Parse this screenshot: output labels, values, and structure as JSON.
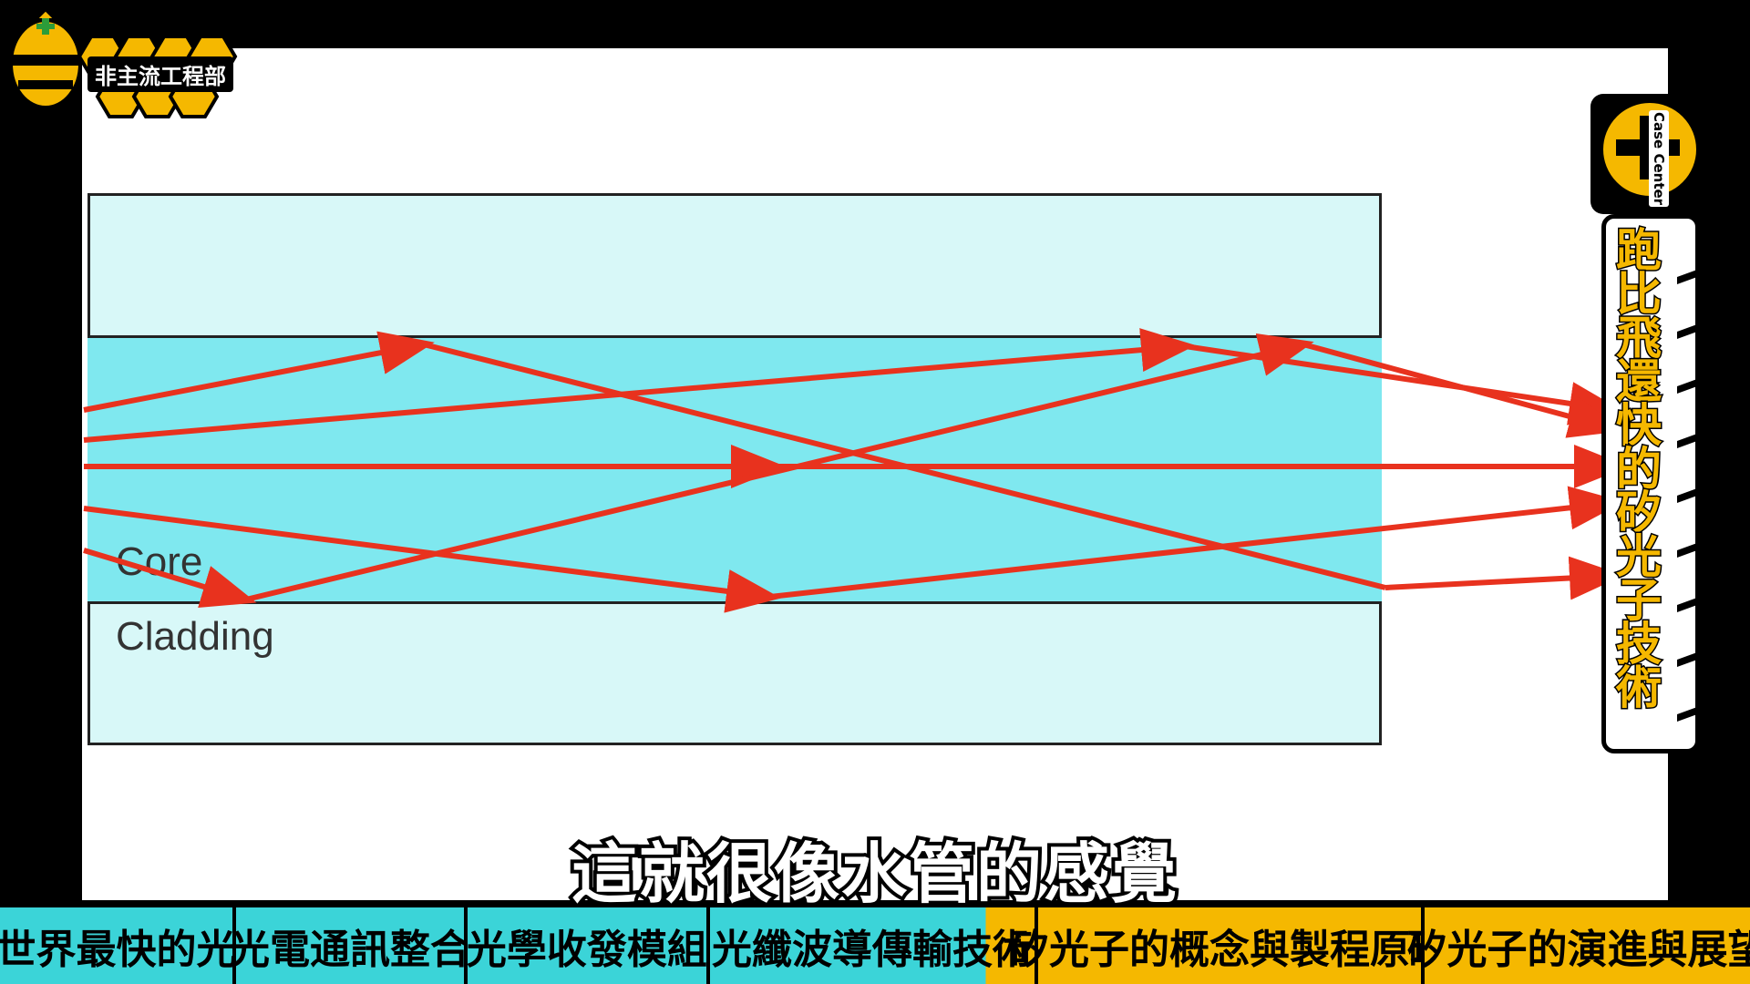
{
  "brand": {
    "name": "非主流工程部"
  },
  "badge": {
    "text": "Case Center"
  },
  "vertical_title": "跑比飛還快的矽光子技術",
  "diagram": {
    "core_label": "Core",
    "cladding_label": "Cladding"
  },
  "subtitle": "這就很像水管的感覺",
  "chapters": [
    {
      "label": "世界最快的光"
    },
    {
      "label": "光電通訊整合"
    },
    {
      "label": "光學收發模組"
    },
    {
      "label": "光纖波導傳輸技術"
    },
    {
      "label": "矽光子的概念與製程原理"
    },
    {
      "label": "矽光子的演進與展望"
    }
  ],
  "colors": {
    "cyan": "#3bd4d8",
    "yellow": "#f5b800",
    "ray": "#e8321e",
    "core": "#7fe8ef",
    "cladding": "#d8f8f8"
  }
}
